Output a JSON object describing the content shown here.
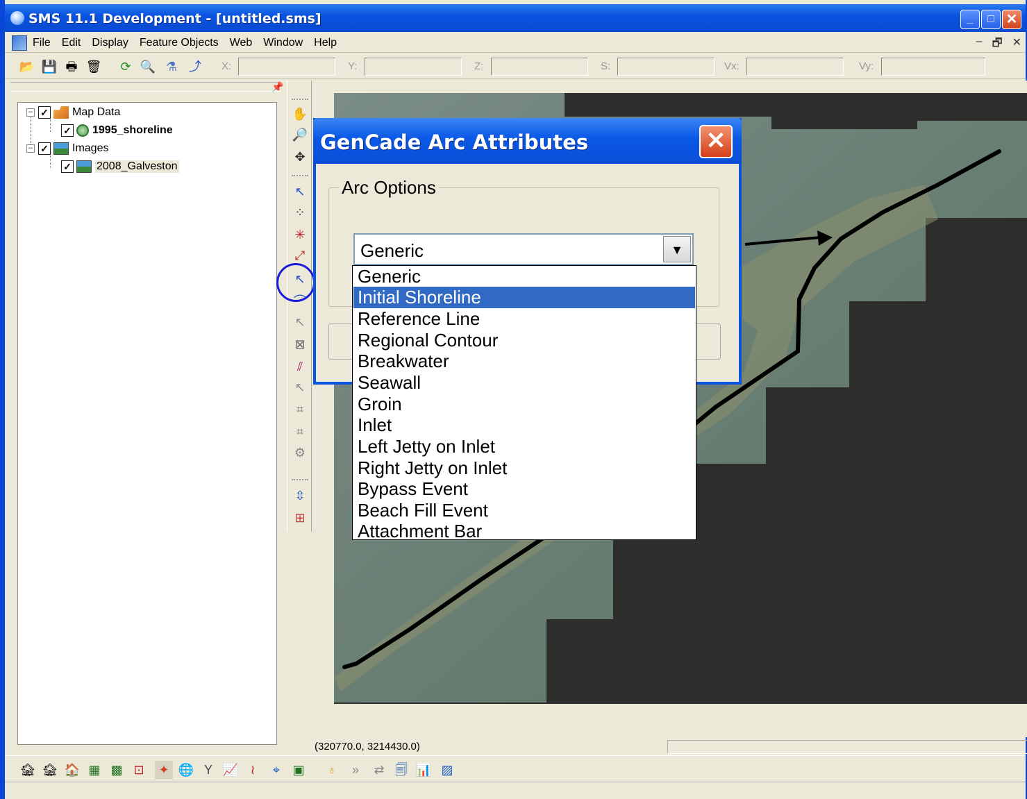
{
  "window": {
    "title": "SMS 11.1 Development - [untitled.sms]",
    "min_label": "_",
    "max_label": "□",
    "close_label": "✕"
  },
  "menu": {
    "items": [
      "File",
      "Edit",
      "Display",
      "Feature Objects",
      "Web",
      "Window",
      "Help"
    ],
    "mdi": [
      "–",
      "🗗",
      "✕"
    ]
  },
  "coords_toolbar": {
    "x_label": "X:",
    "y_label": "Y:",
    "z_label": "Z:",
    "s_label": "S:",
    "vx_label": "Vx:",
    "vy_label": "Vy:"
  },
  "tree": {
    "map_data": {
      "label": "Map Data",
      "expander": "–",
      "checked": "✓"
    },
    "shoreline": {
      "label": "1995_shoreline",
      "checked": "✓"
    },
    "images": {
      "label": "Images",
      "expander": "–",
      "checked": "✓"
    },
    "galveston": {
      "label": "2008_Galveston",
      "checked": "✓"
    }
  },
  "status": {
    "coords": "(320770.0, 3214430.0)"
  },
  "dialog": {
    "title": "GenCade Arc Attributes",
    "close_label": "✕",
    "group_label": "Arc Options",
    "combo_value": "Generic",
    "combo_arrow": "▼",
    "options": [
      "Generic",
      "Initial Shoreline",
      "Reference Line",
      "Regional Contour",
      "Breakwater",
      "Seawall",
      "Groin",
      "Inlet",
      "Left Jetty on Inlet",
      "Right Jetty on Inlet",
      "Bypass Event",
      "Beach Fill Event",
      "Attachment Bar"
    ],
    "highlighted_option": "Initial Shoreline"
  },
  "colors": {
    "titlebar": "#0a54e0",
    "selection": "#316ac5",
    "map_dark": "#2d2d2b",
    "map_water": "#6a7f74",
    "highlight_ring": "#1a1ad8"
  },
  "icons": {
    "toolbar": [
      "open-icon",
      "save-icon",
      "print-icon",
      "delete-icon",
      "refresh-icon",
      "zoom-icon",
      "measure-icon",
      "graph-icon"
    ],
    "vertical": [
      "pan-icon",
      "zoom-icon",
      "rotate-icon",
      "create-arc-icon",
      "create-node-icon",
      "select-node-icon",
      "select-vertex-icon",
      "select-arc-icon",
      "create-polygon-icon",
      "select-polygon-icon",
      "feature-icon",
      "build-icon",
      "select-all-icon",
      "grid-icon",
      "frame-icon",
      "properties-icon"
    ],
    "bottom": [
      "module-1-icon",
      "module-2-icon",
      "module-3-icon",
      "grid-icon",
      "mesh-icon",
      "scatter-icon",
      "map-module-icon",
      "gis-icon",
      "tree-icon",
      "chart-icon",
      "particle-icon",
      "quadtree-icon",
      "image-icon",
      "drop-icon",
      "arrow-icon",
      "link-icon",
      "sheet-icon",
      "bars-icon",
      "image-module-icon"
    ]
  }
}
